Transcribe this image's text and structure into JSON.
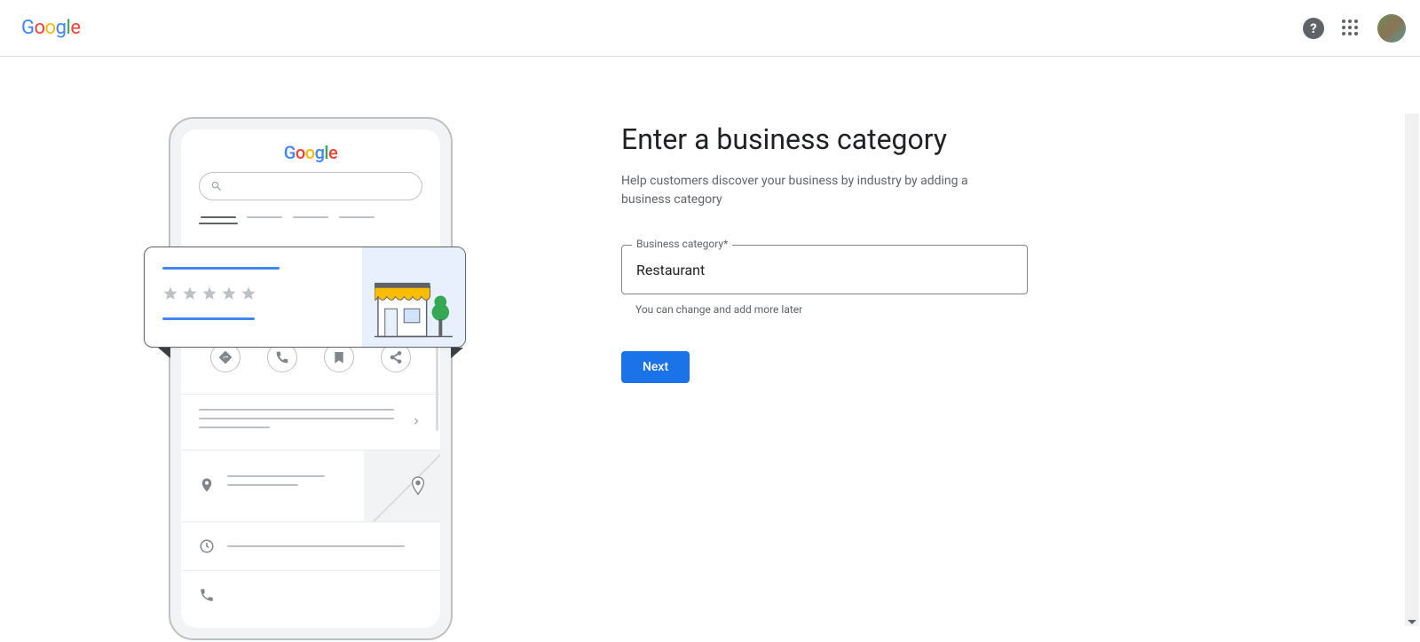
{
  "header": {
    "logo": "Google"
  },
  "form": {
    "heading": "Enter a business category",
    "description": "Help customers discover your business by industry by adding a business category",
    "field_label": "Business category*",
    "field_value": "Restaurant",
    "helper": "You can change and add more later",
    "next_label": "Next"
  },
  "illustration": {
    "phone_logo": "Google"
  }
}
